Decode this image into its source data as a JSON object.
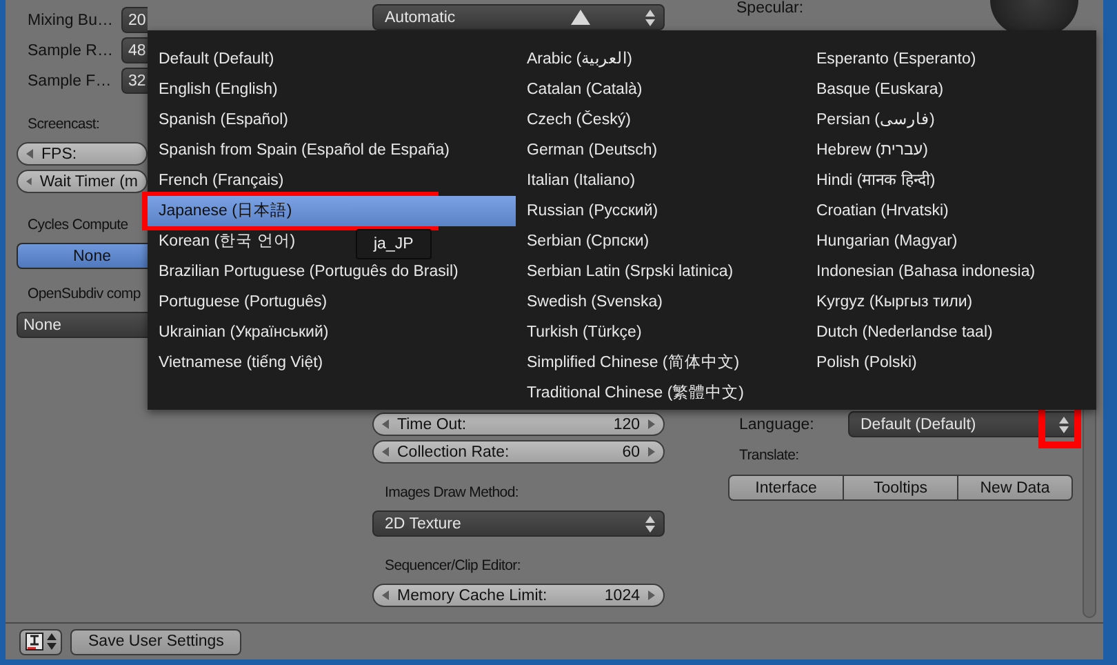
{
  "left_panel": {
    "sound_rows": [
      {
        "label": "Mixing Bu…",
        "value": "20"
      },
      {
        "label": "Sample R…",
        "value": "48"
      },
      {
        "label": "Sample F…",
        "value": "32"
      }
    ],
    "screencast": {
      "label": "Screencast:",
      "fields": [
        {
          "label": "FPS:"
        },
        {
          "label": "Wait Timer (m"
        }
      ]
    },
    "cycles": {
      "label": "Cycles Compute",
      "option": {
        "label": "None",
        "selected": true
      }
    },
    "opensubdiv": {
      "label": "OpenSubdiv comp",
      "value": "None"
    }
  },
  "middle_panel": {
    "top_dropdown": {
      "value": "Automatic"
    },
    "number_fields": [
      {
        "label": "Time Out:",
        "value": "120"
      },
      {
        "label": "Collection Rate:",
        "value": "60"
      }
    ],
    "images_draw_method": {
      "label": "Images Draw Method:",
      "value": "2D Texture"
    },
    "sequencer": {
      "label": "Sequencer/Clip Editor:",
      "field": {
        "label": "Memory Cache Limit:",
        "value": "1024"
      }
    }
  },
  "right_panel": {
    "top_label": "Specular:",
    "language": {
      "label": "Language:",
      "value": "Default (Default)",
      "highlighted": true
    },
    "translate": {
      "label": "Translate:",
      "buttons": [
        {
          "label": "Interface",
          "selected": false
        },
        {
          "label": "Tooltips",
          "selected": false
        },
        {
          "label": "New Data",
          "selected": false
        }
      ]
    }
  },
  "language_menu": {
    "columns": [
      {
        "items": [
          {
            "label": "Default (Default)",
            "selected": false,
            "highlighted": false
          },
          {
            "label": "English (English)",
            "selected": false,
            "highlighted": false
          },
          {
            "label": "Spanish (Español)",
            "selected": false,
            "highlighted": false
          },
          {
            "label": "Spanish from Spain (Español de España)",
            "selected": false,
            "highlighted": false
          },
          {
            "label": "French (Français)",
            "selected": false,
            "highlighted": false
          },
          {
            "label": "Japanese (日本語)",
            "selected": true,
            "highlighted": true
          },
          {
            "label": "Korean (한국 언어)",
            "selected": false,
            "highlighted": false
          },
          {
            "label": "Brazilian Portuguese (Português do Brasil)",
            "selected": false,
            "highlighted": false
          },
          {
            "label": "Portuguese (Português)",
            "selected": false,
            "highlighted": false
          },
          {
            "label": "Ukrainian (Український)",
            "selected": false,
            "highlighted": false
          },
          {
            "label": "Vietnamese (tiếng Việt)",
            "selected": false,
            "highlighted": false
          }
        ]
      },
      {
        "items": [
          {
            "label": "Arabic (العربية)",
            "selected": false,
            "highlighted": false
          },
          {
            "label": "Catalan (Català)",
            "selected": false,
            "highlighted": false
          },
          {
            "label": "Czech (Český)",
            "selected": false,
            "highlighted": false
          },
          {
            "label": "German (Deutsch)",
            "selected": false,
            "highlighted": false
          },
          {
            "label": "Italian (Italiano)",
            "selected": false,
            "highlighted": false
          },
          {
            "label": "Russian (Русский)",
            "selected": false,
            "highlighted": false
          },
          {
            "label": "Serbian (Српски)",
            "selected": false,
            "highlighted": false
          },
          {
            "label": "Serbian Latin (Srpski latinica)",
            "selected": false,
            "highlighted": false
          },
          {
            "label": "Swedish (Svenska)",
            "selected": false,
            "highlighted": false
          },
          {
            "label": "Turkish (Türkçe)",
            "selected": false,
            "highlighted": false
          },
          {
            "label": "Simplified Chinese (简体中文)",
            "selected": false,
            "highlighted": false
          },
          {
            "label": "Traditional Chinese (繁體中文)",
            "selected": false,
            "highlighted": false
          }
        ]
      },
      {
        "items": [
          {
            "label": "Esperanto (Esperanto)",
            "selected": false,
            "highlighted": false
          },
          {
            "label": "Basque (Euskara)",
            "selected": false,
            "highlighted": false
          },
          {
            "label": "Persian (فارسی)",
            "selected": false,
            "highlighted": false
          },
          {
            "label": "Hebrew (עברית)",
            "selected": false,
            "highlighted": false
          },
          {
            "label": "Hindi (मानक हिन्दी)",
            "selected": false,
            "highlighted": false
          },
          {
            "label": "Croatian (Hrvatski)",
            "selected": false,
            "highlighted": false
          },
          {
            "label": "Hungarian (Magyar)",
            "selected": false,
            "highlighted": false
          },
          {
            "label": "Indonesian (Bahasa indonesia)",
            "selected": false,
            "highlighted": false
          },
          {
            "label": "Kyrgyz (Кыргыз тили)",
            "selected": false,
            "highlighted": false
          },
          {
            "label": "Dutch (Nederlandse taal)",
            "selected": false,
            "highlighted": false
          },
          {
            "label": "Polish (Polski)",
            "selected": false,
            "highlighted": false
          }
        ]
      }
    ],
    "tooltip": "ja_JP"
  },
  "bottom_bar": {
    "save_button": "Save User Settings"
  }
}
